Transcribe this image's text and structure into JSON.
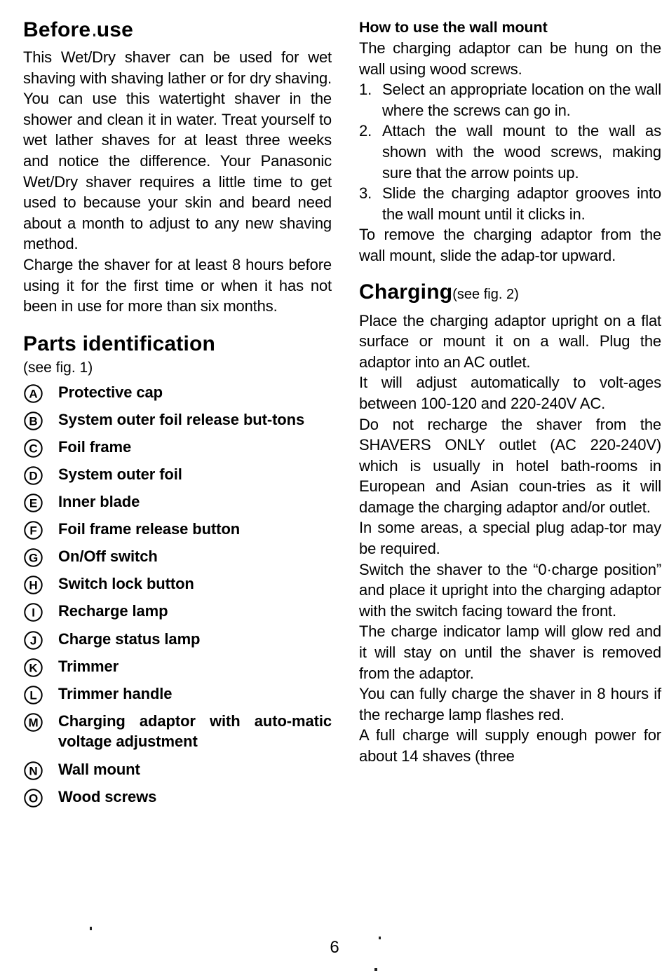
{
  "page": {
    "number": "6"
  },
  "left_column": {
    "heading_before_use": "Before use",
    "paragraphs": [
      "This Wet/Dry shaver can be used for wet shaving with shaving lather or for dry shaving. You can use this watertight shaver in the shower and clean it in water. Treat yourself to wet lather shaves for at least three weeks and notice the difference. Your Panasonic Wet/Dry shaver requires a little time to get used to because your skin and beard need about a month to adjust to any new shaving method.",
      "Charge the shaver for at least 8 hours before using it for the first time or when it has not been in use for more than six months."
    ],
    "heading_parts": "Parts identification",
    "parts_note": "(see fig. 1)",
    "parts": [
      {
        "letter": "A",
        "label": "Protective cap"
      },
      {
        "letter": "B",
        "label": "System outer foil release but-tons"
      },
      {
        "letter": "C",
        "label": "Foil frame"
      },
      {
        "letter": "D",
        "label": "System outer foil"
      },
      {
        "letter": "E",
        "label": "Inner blade"
      },
      {
        "letter": "F",
        "label": "Foil frame release button"
      },
      {
        "letter": "G",
        "label": "On/Off switch"
      },
      {
        "letter": "H",
        "label": "Switch lock button"
      },
      {
        "letter": "I",
        "label": "Recharge lamp"
      },
      {
        "letter": "J",
        "label": "Charge status lamp"
      },
      {
        "letter": "K",
        "label": "Trimmer"
      },
      {
        "letter": "L",
        "label": "Trimmer handle"
      },
      {
        "letter": "M",
        "label": "Charging adaptor with auto-matic voltage adjustment"
      },
      {
        "letter": "N",
        "label": "Wall mount"
      },
      {
        "letter": "O",
        "label": "Wood screws"
      }
    ]
  },
  "right_column": {
    "heading_wall_mount": "How to use the wall mount",
    "wall_mount_intro": "The charging adaptor can be hung on the wall using wood screws.",
    "wall_mount_steps": [
      {
        "num": "1.",
        "text": "Select an appropriate location on the wall where the screws can go in."
      },
      {
        "num": "2.",
        "text": "Attach the wall mount to the wall as shown with the wood screws, making sure that the arrow points up."
      },
      {
        "num": "3.",
        "text": "Slide the charging adaptor grooves into the wall mount until it clicks in."
      }
    ],
    "wall_mount_outro": "To remove the charging adaptor from the wall mount, slide the adap-tor upward.",
    "heading_charging": "Charging",
    "charging_note": "(see fig. 2)",
    "charging_paragraphs": [
      "Place the charging adaptor upright on a flat surface or mount it on a wall. Plug the adaptor into an AC outlet.",
      "It will adjust automatically to volt-ages between 100-120 and 220-240V AC.",
      "Do not recharge the shaver from the SHAVERS ONLY outlet (AC 220-240V) which is usually in hotel bath-rooms in European and Asian coun-tries as it will damage the charging adaptor and/or outlet.",
      "In some areas, a special plug adap-tor may be required.",
      "Switch the shaver to the “0·charge position” and place it upright into the charging adaptor with the switch facing toward the front.",
      "The charge indicator lamp will glow red and it will stay on until the shaver is removed from the adaptor.",
      "You can fully charge the shaver in 8 hours if the recharge lamp flashes red.",
      "A full charge will supply enough power for about 14 shaves (three"
    ]
  }
}
